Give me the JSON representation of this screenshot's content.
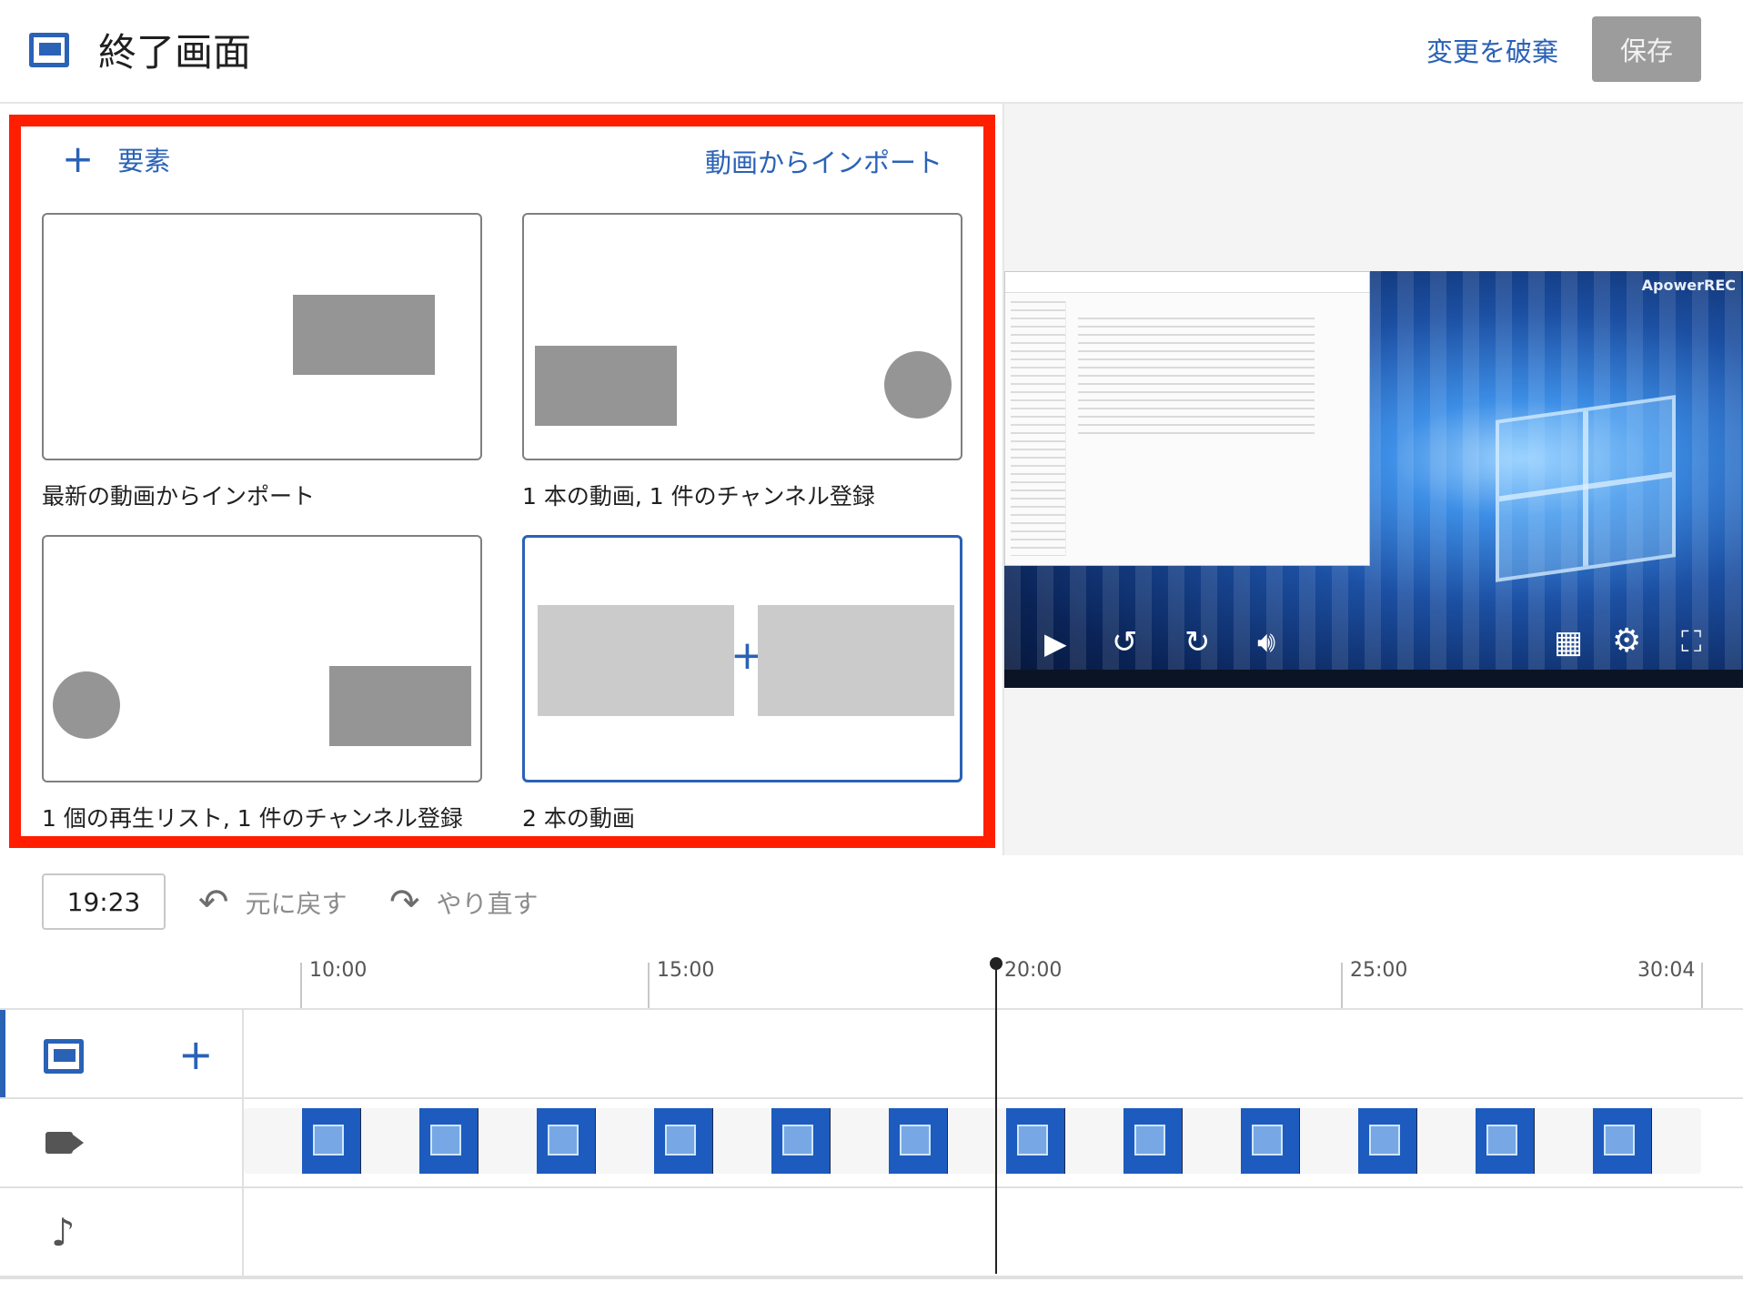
{
  "header": {
    "title": "終了画面",
    "discard_label": "変更を破棄",
    "save_label": "保存"
  },
  "panel": {
    "add_element_icon": "plus-icon",
    "add_element_label": "要素",
    "import_label": "動画からインポート",
    "templates": [
      {
        "label": "最新の動画からインポート",
        "selected": false
      },
      {
        "label": "1 本の動画, 1 件のチャンネル登録",
        "selected": false
      },
      {
        "label": "1 個の再生リスト, 1 件のチャンネル登録",
        "selected": false
      },
      {
        "label": "2 本の動画",
        "selected": true
      }
    ]
  },
  "preview": {
    "watermark": "ApowerREC",
    "controls": [
      "play-icon",
      "rewind-10-icon",
      "forward-10-icon",
      "volume-icon",
      "grid-icon",
      "settings-icon",
      "fullscreen-icon"
    ]
  },
  "editor": {
    "time": "19:23",
    "undo_label": "元に戻す",
    "redo_label": "やり直す"
  },
  "timeline": {
    "ticks": [
      "10:00",
      "15:00",
      "20:00",
      "25:00",
      "30:04"
    ],
    "tracks": [
      "endscreen-icon",
      "camera-icon",
      "music-icon"
    ]
  },
  "colors": {
    "accent": "#2a62b6",
    "highlight": "#ff1e00",
    "save_bg": "#9c9c9c"
  }
}
